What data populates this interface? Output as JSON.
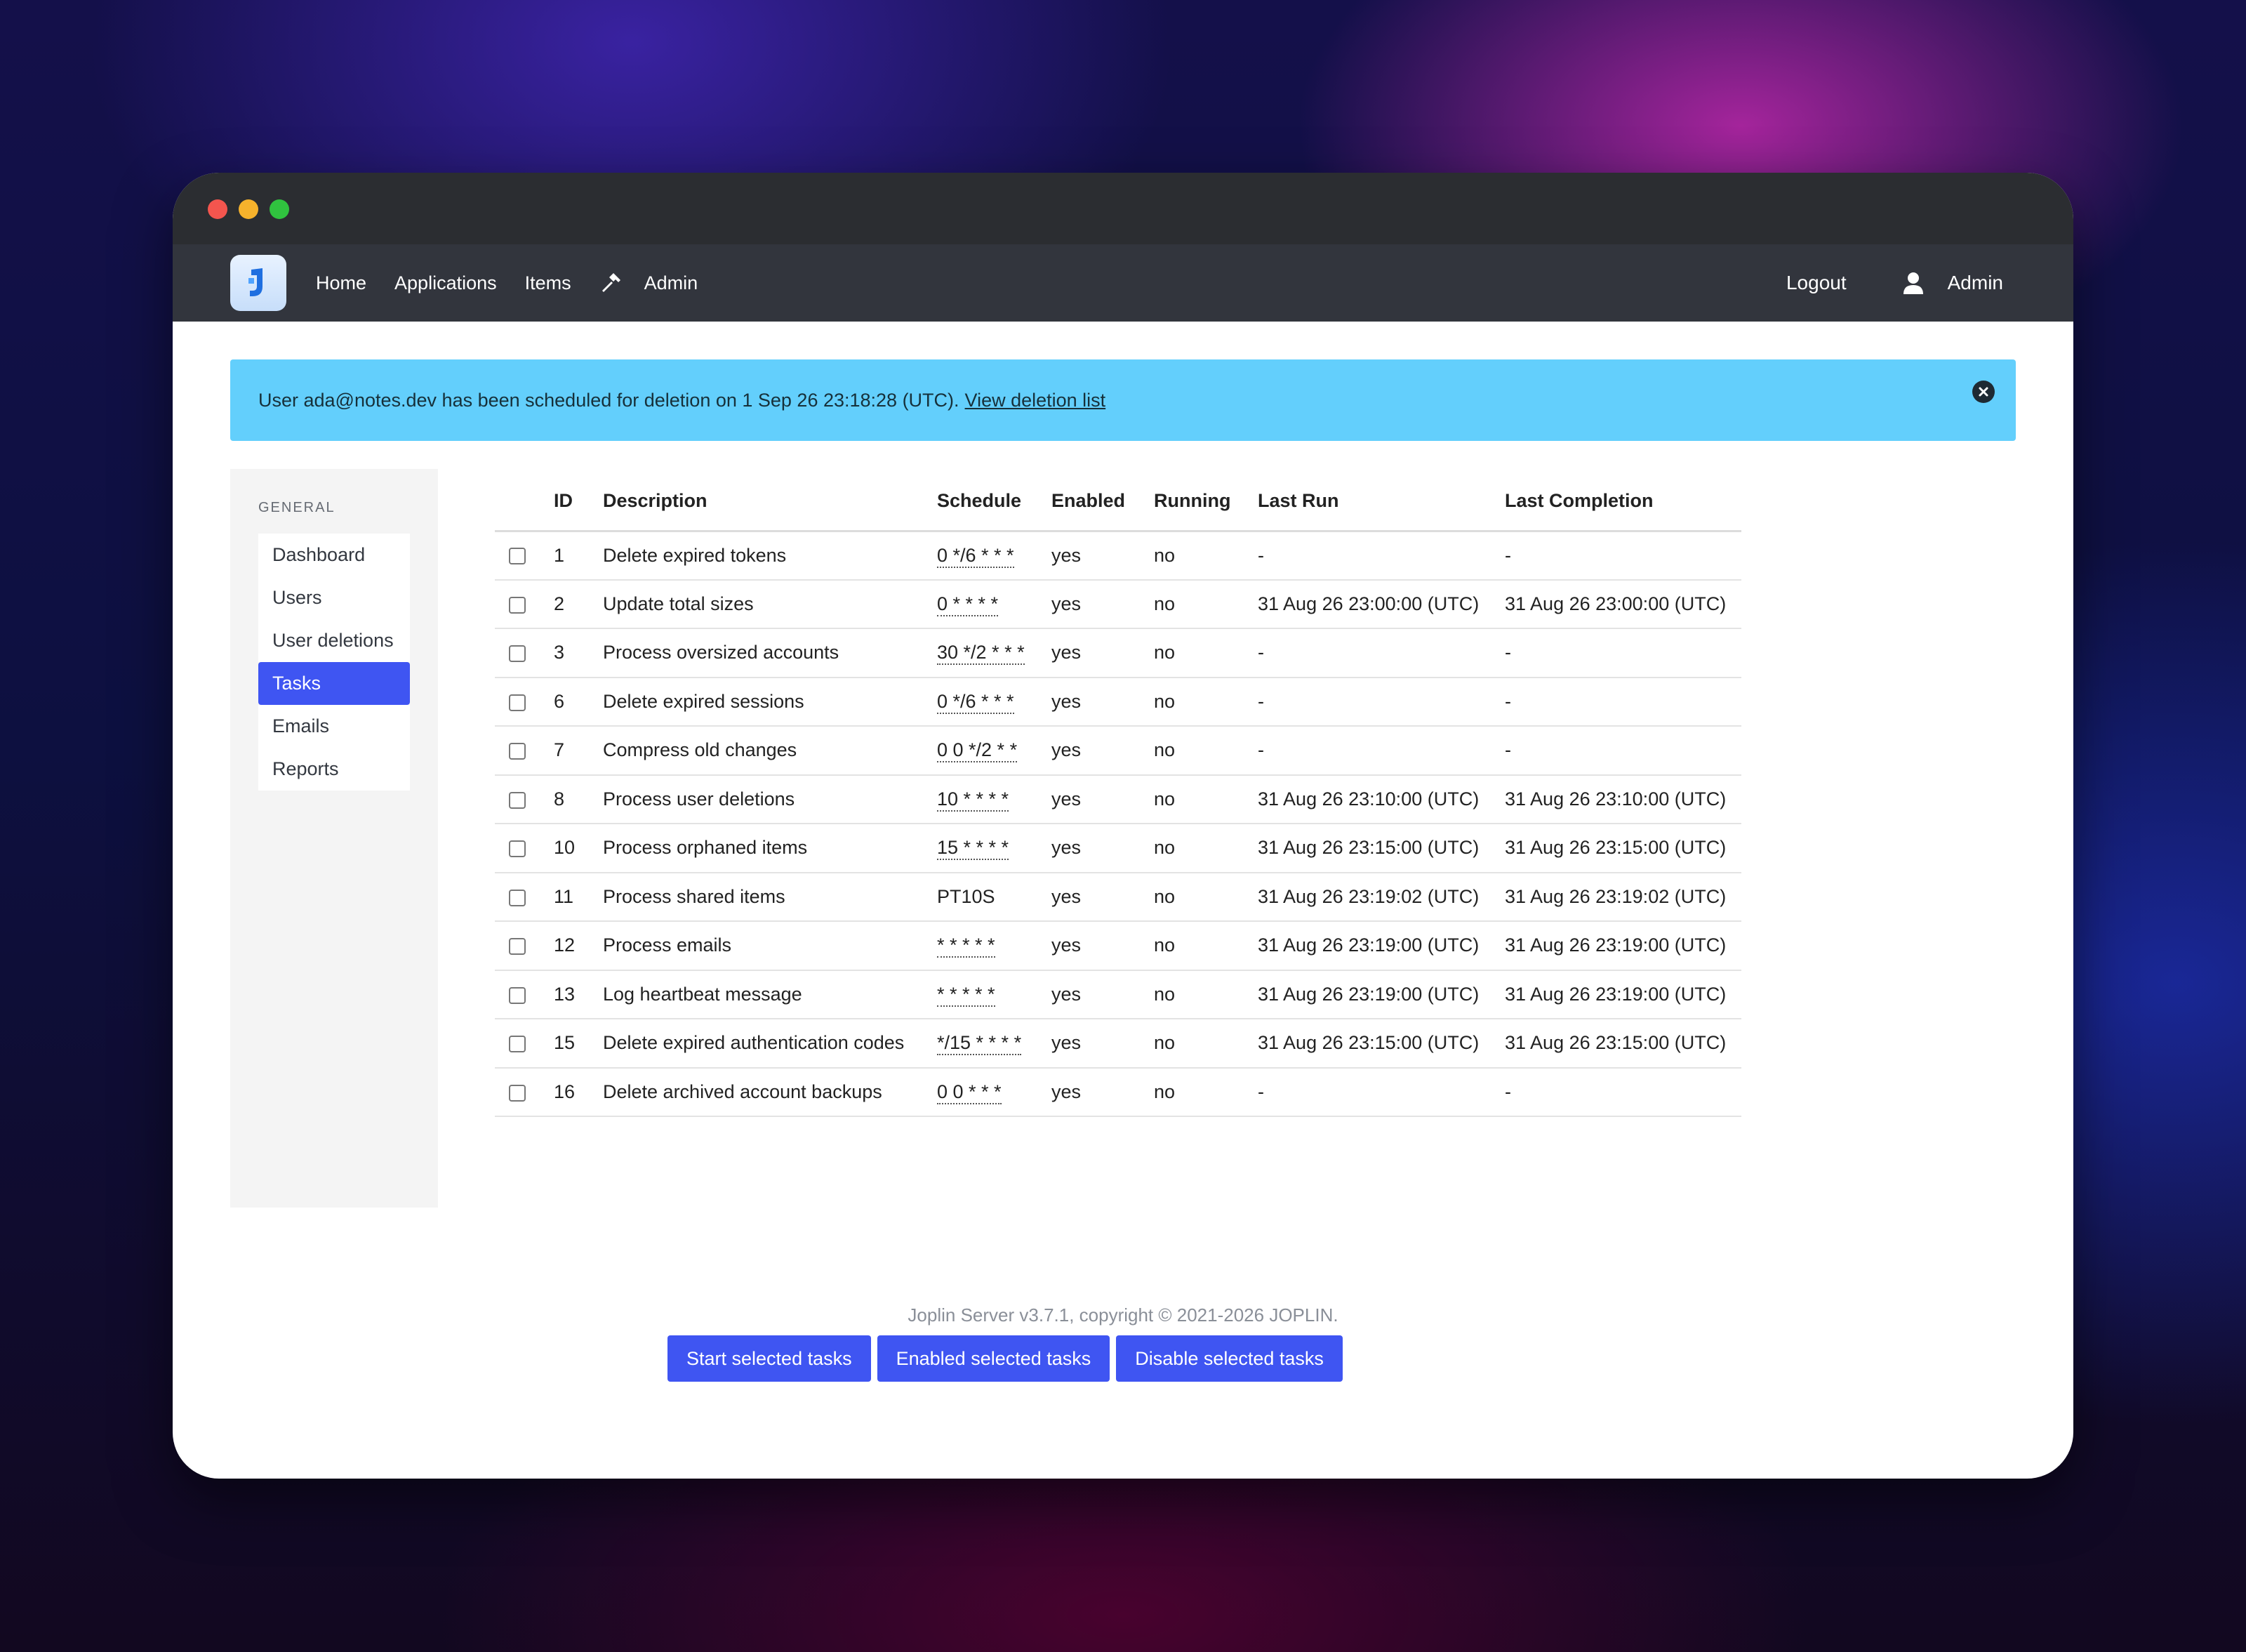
{
  "navbar": {
    "items": [
      "Home",
      "Applications",
      "Items"
    ],
    "admin_label": "Admin",
    "logout_label": "Logout",
    "user_label": "Admin",
    "logo_icon": "joplin-logo-icon",
    "tool_icon": "hammer-icon",
    "user_icon": "user-icon"
  },
  "alert": {
    "message": "User ada@notes.dev has been scheduled for deletion on 1 Sep 26 23:18:28 (UTC).",
    "link": "View deletion list",
    "close_icon": "close-circle-icon"
  },
  "sidebar": {
    "heading": "GENERAL",
    "items": [
      "Dashboard",
      "Users",
      "User deletions",
      "Tasks",
      "Emails",
      "Reports"
    ],
    "active": "Tasks"
  },
  "table": {
    "columns": [
      "",
      "ID",
      "Description",
      "Schedule",
      "Enabled",
      "Running",
      "Last Run",
      "Last Completion"
    ],
    "rows": [
      {
        "id": "1",
        "description": "Delete expired tokens",
        "schedule": "0 */6 * * *",
        "schedule_dotted": true,
        "enabled": "yes",
        "running": "no",
        "last_run": "-",
        "last_completion": "-"
      },
      {
        "id": "2",
        "description": "Update total sizes",
        "schedule": "0 * * * *",
        "schedule_dotted": true,
        "enabled": "yes",
        "running": "no",
        "last_run": "31 Aug 26 23:00:00 (UTC)",
        "last_completion": "31 Aug 26 23:00:00 (UTC)"
      },
      {
        "id": "3",
        "description": "Process oversized accounts",
        "schedule": "30 */2 * * *",
        "schedule_dotted": true,
        "enabled": "yes",
        "running": "no",
        "last_run": "-",
        "last_completion": "-"
      },
      {
        "id": "6",
        "description": "Delete expired sessions",
        "schedule": "0 */6 * * *",
        "schedule_dotted": true,
        "enabled": "yes",
        "running": "no",
        "last_run": "-",
        "last_completion": "-"
      },
      {
        "id": "7",
        "description": "Compress old changes",
        "schedule": "0 0 */2 * *",
        "schedule_dotted": true,
        "enabled": "yes",
        "running": "no",
        "last_run": "-",
        "last_completion": "-"
      },
      {
        "id": "8",
        "description": "Process user deletions",
        "schedule": "10 * * * *",
        "schedule_dotted": true,
        "enabled": "yes",
        "running": "no",
        "last_run": "31 Aug 26 23:10:00 (UTC)",
        "last_completion": "31 Aug 26 23:10:00 (UTC)"
      },
      {
        "id": "10",
        "description": "Process orphaned items",
        "schedule": "15 * * * *",
        "schedule_dotted": true,
        "enabled": "yes",
        "running": "no",
        "last_run": "31 Aug 26 23:15:00 (UTC)",
        "last_completion": "31 Aug 26 23:15:00 (UTC)"
      },
      {
        "id": "11",
        "description": "Process shared items",
        "schedule": "PT10S",
        "schedule_dotted": false,
        "enabled": "yes",
        "running": "no",
        "last_run": "31 Aug 26 23:19:02 (UTC)",
        "last_completion": "31 Aug 26 23:19:02 (UTC)"
      },
      {
        "id": "12",
        "description": "Process emails",
        "schedule": "* * * * *",
        "schedule_dotted": true,
        "enabled": "yes",
        "running": "no",
        "last_run": "31 Aug 26 23:19:00 (UTC)",
        "last_completion": "31 Aug 26 23:19:00 (UTC)"
      },
      {
        "id": "13",
        "description": "Log heartbeat message",
        "schedule": "* * * * *",
        "schedule_dotted": true,
        "enabled": "yes",
        "running": "no",
        "last_run": "31 Aug 26 23:19:00 (UTC)",
        "last_completion": "31 Aug 26 23:19:00 (UTC)"
      },
      {
        "id": "15",
        "description": "Delete expired authentication codes",
        "schedule": "*/15 * * * *",
        "schedule_dotted": true,
        "enabled": "yes",
        "running": "no",
        "last_run": "31 Aug 26 23:15:00 (UTC)",
        "last_completion": "31 Aug 26 23:15:00 (UTC)"
      },
      {
        "id": "16",
        "description": "Delete archived account backups",
        "schedule": "0 0 * * *",
        "schedule_dotted": true,
        "enabled": "yes",
        "running": "no",
        "last_run": "-",
        "last_completion": "-"
      }
    ]
  },
  "actions": {
    "start": "Start selected tasks",
    "enable": "Enabled selected tasks",
    "disable": "Disable selected tasks"
  },
  "footer": {
    "text": "Joplin Server v3.7.1, copyright © 2021-2026 JOPLIN."
  },
  "colors": {
    "accent": "#3f55f2",
    "alert_bg": "#63cffc",
    "navbar_bg": "#32353d",
    "titlebar_bg": "#2b2d31"
  }
}
